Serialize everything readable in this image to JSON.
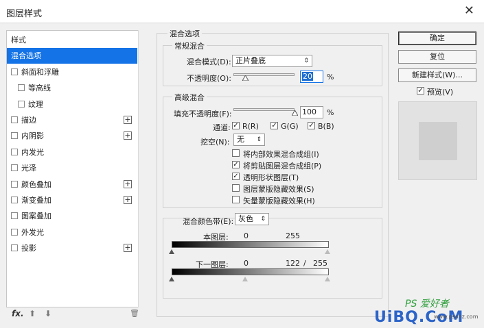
{
  "window": {
    "title": "图层样式",
    "close_glyph": "✕"
  },
  "sidebar": {
    "items": [
      {
        "label": "样式",
        "checkbox": false,
        "plus": false,
        "indent": 0,
        "selected": false
      },
      {
        "label": "混合选项",
        "checkbox": false,
        "plus": false,
        "indent": 0,
        "selected": true
      },
      {
        "label": "斜面和浮雕",
        "checkbox": true,
        "plus": false,
        "indent": 0,
        "selected": false
      },
      {
        "label": "等高线",
        "checkbox": true,
        "plus": false,
        "indent": 1,
        "selected": false
      },
      {
        "label": "纹理",
        "checkbox": true,
        "plus": false,
        "indent": 1,
        "selected": false
      },
      {
        "label": "描边",
        "checkbox": true,
        "plus": true,
        "indent": 0,
        "selected": false
      },
      {
        "label": "内阴影",
        "checkbox": true,
        "plus": true,
        "indent": 0,
        "selected": false
      },
      {
        "label": "内发光",
        "checkbox": true,
        "plus": false,
        "indent": 0,
        "selected": false
      },
      {
        "label": "光泽",
        "checkbox": true,
        "plus": false,
        "indent": 0,
        "selected": false
      },
      {
        "label": "颜色叠加",
        "checkbox": true,
        "plus": true,
        "indent": 0,
        "selected": false
      },
      {
        "label": "渐变叠加",
        "checkbox": true,
        "plus": true,
        "indent": 0,
        "selected": false
      },
      {
        "label": "图案叠加",
        "checkbox": true,
        "plus": false,
        "indent": 0,
        "selected": false
      },
      {
        "label": "外发光",
        "checkbox": true,
        "plus": false,
        "indent": 0,
        "selected": false
      },
      {
        "label": "投影",
        "checkbox": true,
        "plus": true,
        "indent": 0,
        "selected": false
      }
    ],
    "plus_glyph": "+",
    "footer": {
      "fx": "fx.",
      "up": "⬆",
      "down": "⬇",
      "trash": "🗑"
    }
  },
  "blend": {
    "section_title": "混合选项",
    "general": {
      "title": "常规混合",
      "mode_label": "混合模式(D):",
      "mode_value": "正片叠底",
      "opacity_label": "不透明度(O):",
      "opacity_value": "20",
      "opacity_level": 0.2,
      "percent": "%"
    },
    "advanced": {
      "title": "高级混合",
      "fill_label": "填充不透明度(F):",
      "fill_value": "100",
      "fill_level": 1.0,
      "percent": "%",
      "channels_label": "通道:",
      "channel_r": "R(R)",
      "channel_g": "G(G)",
      "channel_b": "B(B)",
      "knockout_label": "挖空(N):",
      "knockout_value": "无",
      "options": [
        {
          "label": "将内部效果混合成组(I)",
          "checked": false
        },
        {
          "label": "将剪贴图层混合成组(P)",
          "checked": true
        },
        {
          "label": "透明形状图层(T)",
          "checked": true
        },
        {
          "label": "图层蒙版隐藏效果(S)",
          "checked": false
        },
        {
          "label": "矢量蒙版隐藏效果(H)",
          "checked": false
        }
      ]
    },
    "blend_if": {
      "label": "混合颜色带(E):",
      "value": "灰色",
      "this_layer": {
        "label": "本图层:",
        "low": "0",
        "high": "255"
      },
      "under_layer": {
        "label": "下一图层:",
        "low": "0",
        "high_a": "122",
        "slash": "/",
        "high_b": "255"
      }
    }
  },
  "buttons": {
    "ok": "确定",
    "reset": "复位",
    "new_style": "新建样式(W)...",
    "preview": "预览(V)"
  },
  "check_glyph": "✓",
  "watermark": {
    "ps": "PS 爱好者",
    "uibq": "UiBQ.CoM",
    "site": "www.psahz.com"
  }
}
